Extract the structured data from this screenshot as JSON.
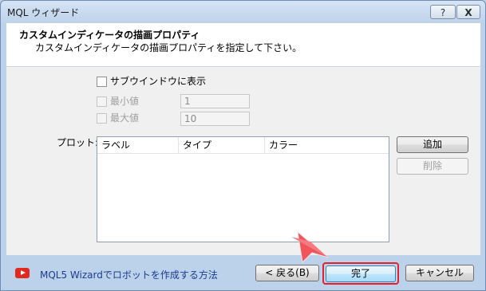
{
  "window": {
    "title": "MQL ウィザード",
    "help_label": "?",
    "close_label": "X"
  },
  "header": {
    "title": "カスタムインディケータの描画プロパティ",
    "subtitle": "カスタムインディケータの描画プロパティを指定して下さい。"
  },
  "options": {
    "subwindow": {
      "label": "サブウインドウに表示",
      "checked": false
    },
    "minimum": {
      "label": "最小値",
      "value": "1",
      "checked": false,
      "enabled": false
    },
    "maximum": {
      "label": "最大値",
      "value": "10",
      "checked": false,
      "enabled": false
    }
  },
  "plots": {
    "label": "プロット:",
    "columns": [
      "ラベル",
      "タイプ",
      "カラー"
    ],
    "rows": [],
    "add_label": "追加",
    "delete_label": "削除"
  },
  "footer": {
    "help_link": "MQL5 Wizardでロボットを作成する方法",
    "back_label": "< 戻る(B)",
    "finish_label": "完了",
    "cancel_label": "キャンセル"
  },
  "colors": {
    "highlight": "#e3212c",
    "arrow": "#f2545b",
    "youtube": "#e02a20"
  }
}
